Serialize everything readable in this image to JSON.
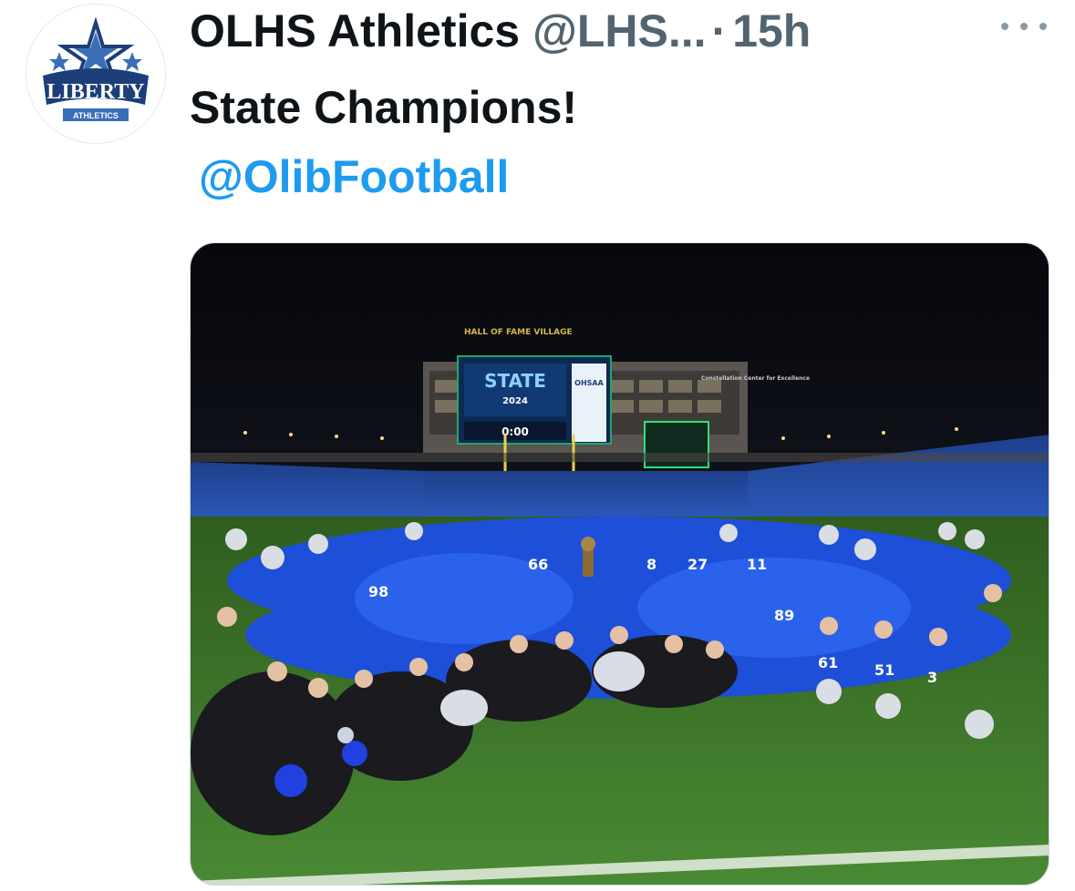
{
  "account": {
    "display_name": "OLHS Athletics",
    "handle": "@LHS...",
    "separator": "·",
    "timestamp": "15h",
    "avatar_icon": "liberty-athletics-logo",
    "avatar_text": "LIBERTY",
    "avatar_subtext": "ATHLETICS"
  },
  "tweet": {
    "text": "State Champions!",
    "mention": "@OlibFootball"
  },
  "media": {
    "scoreboard": {
      "sign_top": "HALL OF FAME VILLAGE",
      "title": "STATE",
      "year": "2024",
      "badge": "OHSAA",
      "clock": "0:00",
      "side_sign": "Constellation Center for Excellence"
    }
  },
  "colors": {
    "text_primary": "#0f1419",
    "text_secondary": "#536471",
    "link": "#1d9bf0",
    "liberty_navy": "#1c3f7a",
    "uniform_blue": "#1d4fd8",
    "turf": "#3f7a2a"
  }
}
